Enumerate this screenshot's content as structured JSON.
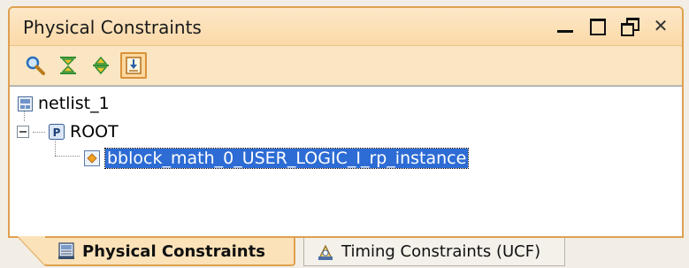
{
  "window": {
    "title": "Physical Constraints",
    "close_glyph": "✕"
  },
  "toolbar": {
    "icons": [
      "search-icon",
      "collapse-all-icon",
      "expand-all-icon",
      "import-icon"
    ]
  },
  "tree": {
    "root": "netlist_1",
    "child": "ROOT",
    "child_badge": "P",
    "leaf": "bblock_math_0_USER_LOGIC_I_rp_instance"
  },
  "tabs": [
    {
      "label": "Physical Constraints",
      "icon": "constraints-icon",
      "active": true
    },
    {
      "label": "Timing Constraints (UCF)",
      "icon": "timing-icon",
      "active": false
    }
  ],
  "colors": {
    "accent": "#e0a050",
    "selection": "#2d6cd4",
    "titlebar": "#fde8c8"
  }
}
